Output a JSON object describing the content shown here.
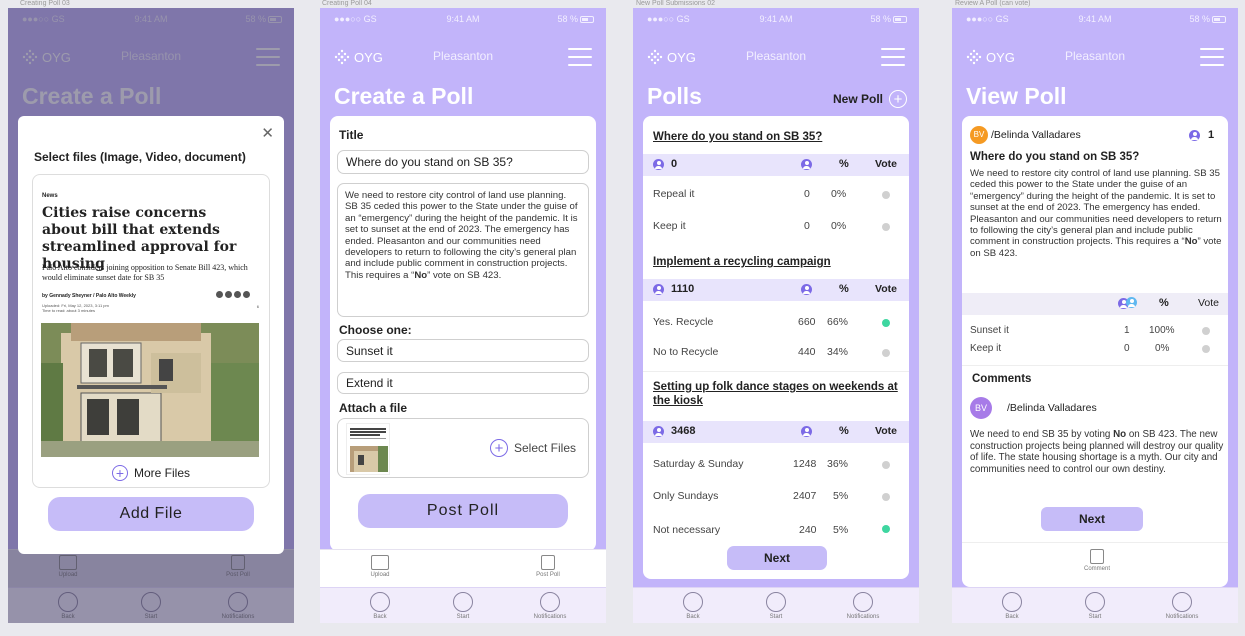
{
  "captions": [
    "Creating Poll 03",
    "Creating Poll 04",
    "New Poll Submissions 02",
    "Review A Poll (can vote)"
  ],
  "status": {
    "carrier": "●●●○○ GS",
    "time": "9:41 AM",
    "battery": "58 %"
  },
  "header": {
    "logo": "OYG",
    "city": "Pleasanton"
  },
  "nav": {
    "back": "Back",
    "start": "Start",
    "notifications": "Notifications"
  },
  "s1": {
    "title": "Create a Poll",
    "modal_title": "Select files (Image, Video, document)",
    "close": "✕",
    "article": {
      "section": "News",
      "headline": "Cities raise concerns about bill that extends streamlined approval for housing",
      "dek": "Palo Alto considers joining opposition to Senate Bill 423, which would eliminate sunset date for SB 35",
      "byline": "by Gennady Sheyner / Palo Alto Weekly",
      "uploaded": "Uploaded: Fri, May 12, 2023, 3:11 pm",
      "timeread": "Time to read: about 3 minutes",
      "comments": "6"
    },
    "more_files": "More Files",
    "add_file": "Add File",
    "upload": "Upload",
    "post_poll": "Post Poll"
  },
  "s2": {
    "title": "Create a Poll",
    "title_label": "Title",
    "title_value": "Where do you stand on SB 35?",
    "description_pre": "We need to restore city control of land use planning.  SB 35 ceded this power to the State under the guise of an “emergency” during the height of the pandemic.  It is set to sunset at the end of 2023.  The emergency has ended.  Pleasanton and our communities need developers to return to following the city’s general plan and include public comment in construction projects.  This requires a “",
    "description_bold": "No",
    "description_post": "” vote on SB 423.",
    "choose_label": "Choose one:",
    "choices": [
      "Sunset it",
      "Extend it"
    ],
    "attach_label": "Attach a file",
    "select_files": "Select Files",
    "post_poll_button": "Post Poll",
    "upload": "Upload",
    "post_poll": "Post Poll"
  },
  "s3": {
    "title": "Polls",
    "new_poll": "New Poll",
    "col_pct": "%",
    "col_vote": "Vote",
    "polls": [
      {
        "question": "Where do you stand on SB 35?",
        "total": "0",
        "rows": [
          {
            "label": "Repeal it",
            "count": "0",
            "pct": "0%",
            "selected": false
          },
          {
            "label": "Keep it",
            "count": "0",
            "pct": "0%",
            "selected": false
          }
        ]
      },
      {
        "question": "Implement a recycling campaign",
        "total": "1110",
        "rows": [
          {
            "label": "Yes. Recycle",
            "count": "660",
            "pct": "66%",
            "selected": true
          },
          {
            "label": "No to Recycle",
            "count": "440",
            "pct": "34%",
            "selected": false
          }
        ]
      },
      {
        "question": "Setting up folk dance stages on weekends at the kiosk",
        "total": "3468",
        "rows": [
          {
            "label": "Saturday & Sunday",
            "count": "1248",
            "pct": "36%",
            "selected": false
          },
          {
            "label": "Only Sundays",
            "count": "2407",
            "pct": "5%",
            "selected": false
          },
          {
            "label": "Not necessary",
            "count": "240",
            "pct": "5%",
            "selected": true
          }
        ]
      }
    ],
    "next": "Next"
  },
  "s4": {
    "title": "View Poll",
    "avatar": "BV",
    "author": "/Belinda Valladares",
    "participants": "1",
    "question": "Where do you stand on SB 35?",
    "body_pre": "We need to restore city control of land use planning.  SB 35 ceded this power to the State under the guise of an “emergency” during the height of the pandemic.  It is set to sunset at the end of 2023.  The emergency has ended.  Pleasanton and our communities need developers to return to following the city’s general plan and include public comment in construction projects.  This requires a “",
    "body_bold": "No",
    "body_post": "” vote on SB 423.",
    "col_pct": "%",
    "col_vote": "Vote",
    "rows": [
      {
        "label": "Sunset it",
        "count": "1",
        "pct": "100%"
      },
      {
        "label": "Keep it",
        "count": "0",
        "pct": "0%"
      }
    ],
    "comments_label": "Comments",
    "comment_author": "/Belinda Valladares",
    "comment_pre": "We need to end SB 35 by voting ",
    "comment_bold": "No",
    "comment_post": " on SB 423.  The new construction projects being planned will destroy our quality of life.  The state housing shortage is a myth.  Our city and communities need to control our own destiny.",
    "next": "Next",
    "comment_tab": "Comment"
  },
  "colors": {
    "brand": "#c2b4fa",
    "accent": "#7c6ae6",
    "button": "#c6bcf8",
    "selected": "#3ed6a0",
    "avatar_orange": "#f59a23",
    "avatar_purple": "#a77be8"
  },
  "icons": [
    "grid-dots-logo-icon",
    "hamburger-menu-icon",
    "close-icon",
    "plus-circle-icon",
    "person-icon",
    "radio-dot-icon",
    "upload-icon",
    "edit-icon",
    "nav-circle-icon"
  ]
}
